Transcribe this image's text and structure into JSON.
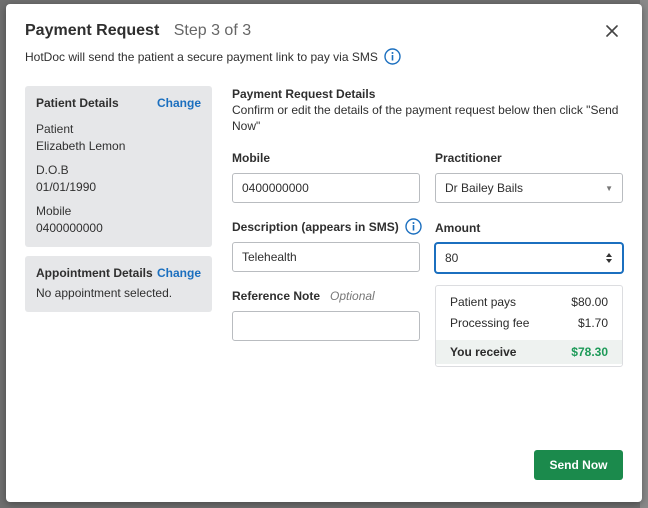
{
  "header": {
    "title": "Payment Request",
    "step": "Step 3 of 3",
    "subtitle": "HotDoc will send the patient a secure payment link to pay via SMS"
  },
  "patient_card": {
    "title": "Patient Details",
    "change_label": "Change",
    "fields": [
      {
        "label": "Patient",
        "value": "Elizabeth Lemon"
      },
      {
        "label": "D.O.B",
        "value": "01/01/1990"
      },
      {
        "label": "Mobile",
        "value": "0400000000"
      }
    ]
  },
  "appointment_card": {
    "title": "Appointment Details",
    "change_label": "Change",
    "message": "No appointment selected."
  },
  "form": {
    "section_title": "Payment Request Details",
    "section_desc": "Confirm or edit the details of the payment request below then click \"Send Now\"",
    "mobile_label": "Mobile",
    "mobile_value": "0400000000",
    "practitioner_label": "Practitioner",
    "practitioner_value": "Dr Bailey Bails",
    "description_label": "Description (appears in SMS)",
    "description_value": "Telehealth",
    "amount_label": "Amount",
    "amount_value": "80",
    "reference_label": "Reference Note",
    "reference_optional": "Optional",
    "reference_value": ""
  },
  "summary": {
    "patient_pays_label": "Patient pays",
    "patient_pays_value": "$80.00",
    "fee_label": "Processing fee",
    "fee_value": "$1.70",
    "receive_label": "You receive",
    "receive_value": "$78.30"
  },
  "actions": {
    "send_label": "Send Now"
  },
  "colors": {
    "accent": "#1b6fbf",
    "primary_button": "#1b8a4c",
    "receive_green": "#1d9a58",
    "card_bg": "#e6e7e9"
  }
}
